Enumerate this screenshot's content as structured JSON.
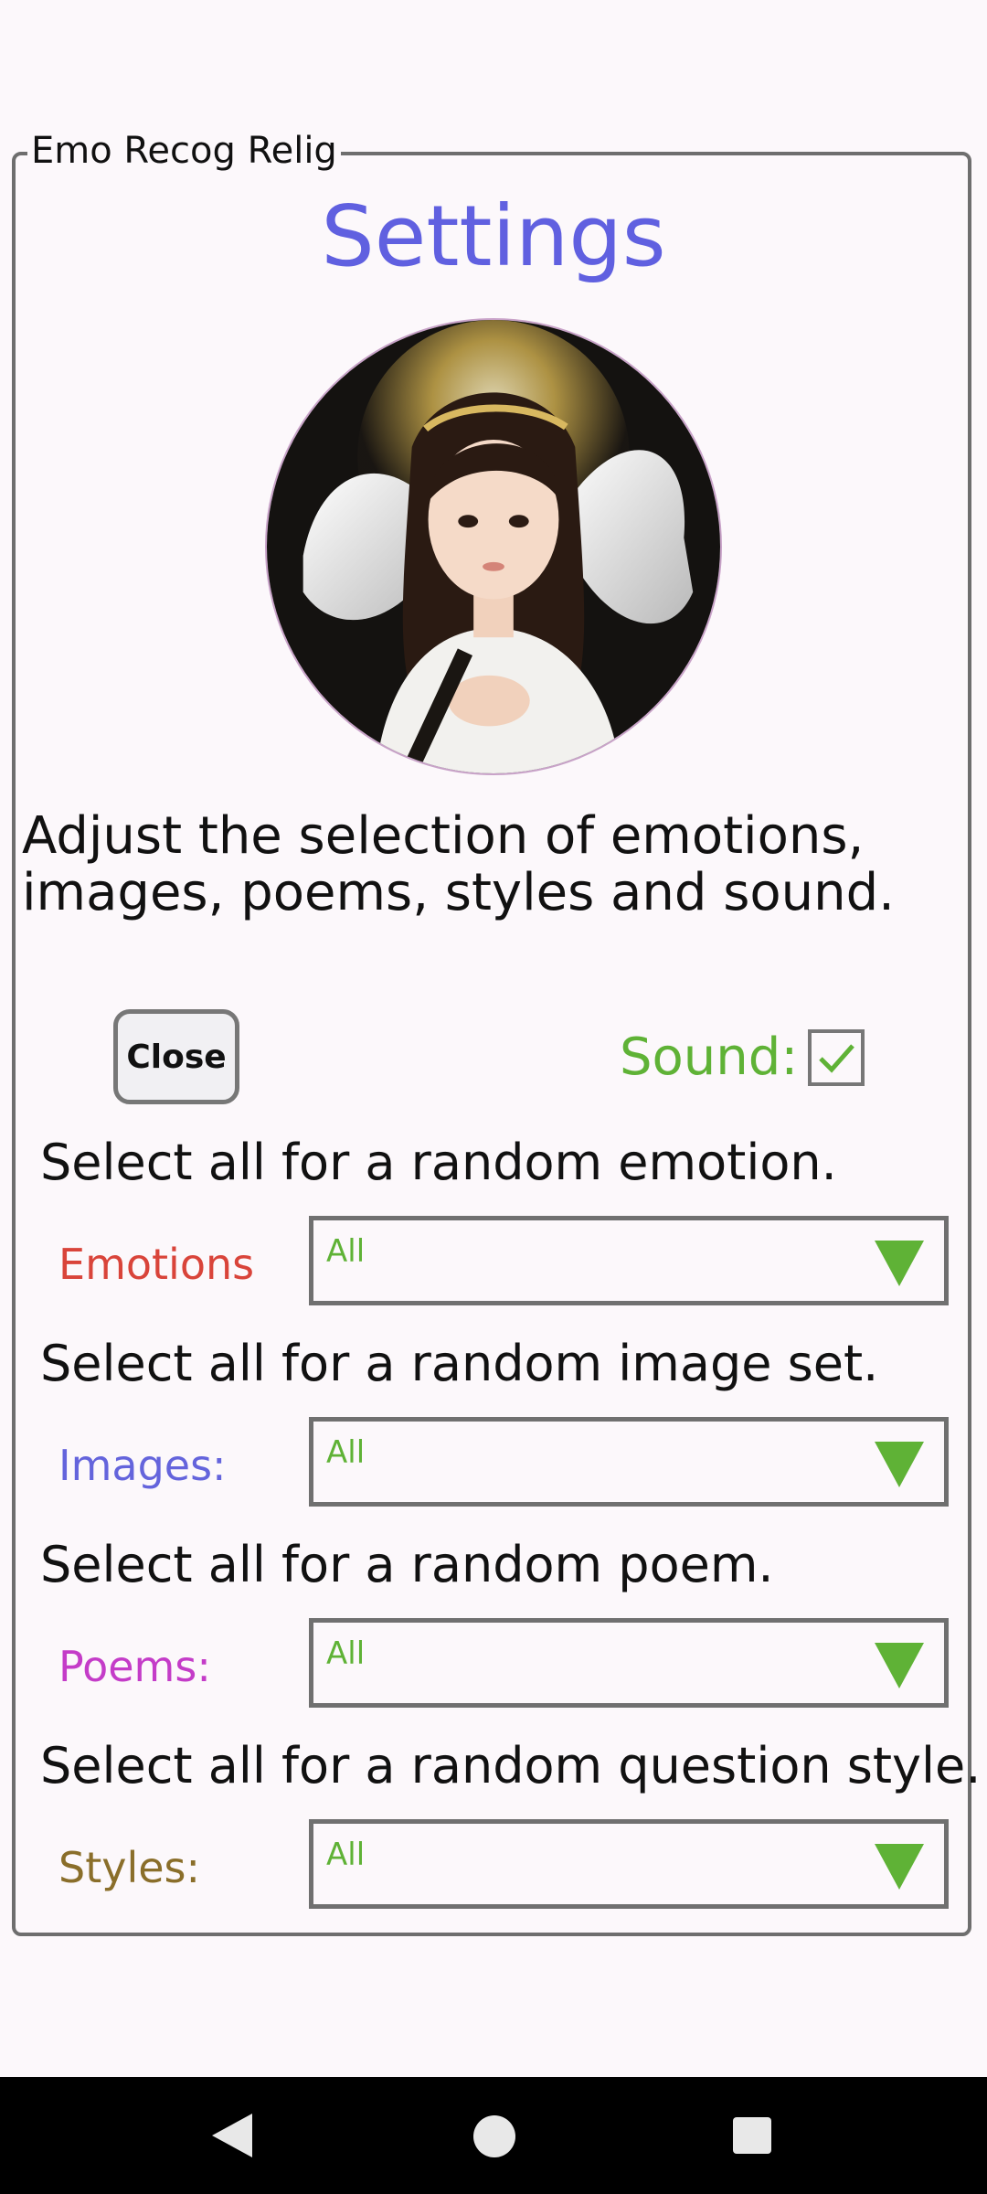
{
  "app": {
    "legend": "Emo Recog Relig"
  },
  "header": {
    "title": "Settings"
  },
  "description": "Adjust the selection of emotions, images, poems, styles and sound.",
  "controls": {
    "close_label": "Close",
    "sound_label": "Sound:",
    "sound_checked": true
  },
  "sections": [
    {
      "hint": "Select all for a random emotion.",
      "label": "Emotions",
      "value": "All",
      "label_color": "#d9443a"
    },
    {
      "hint": "Select all for a random image set.",
      "label": "Images:",
      "value": "All",
      "label_color": "#6464dc"
    },
    {
      "hint": "Select all for a random poem.",
      "label": "Poems:",
      "value": "All",
      "label_color": "#c43cc8"
    },
    {
      "hint": "Select all for a random question style.",
      "label": "Styles:",
      "value": "All",
      "label_color": "#8a6e2a"
    }
  ],
  "colors": {
    "accent_title": "#6060e0",
    "accent_green": "#5fb236",
    "border": "#707070"
  },
  "icons": {
    "checkbox": "check-icon",
    "dropdown": "triangle-down-icon",
    "nav": [
      "back-icon",
      "home-icon",
      "recents-icon"
    ]
  }
}
